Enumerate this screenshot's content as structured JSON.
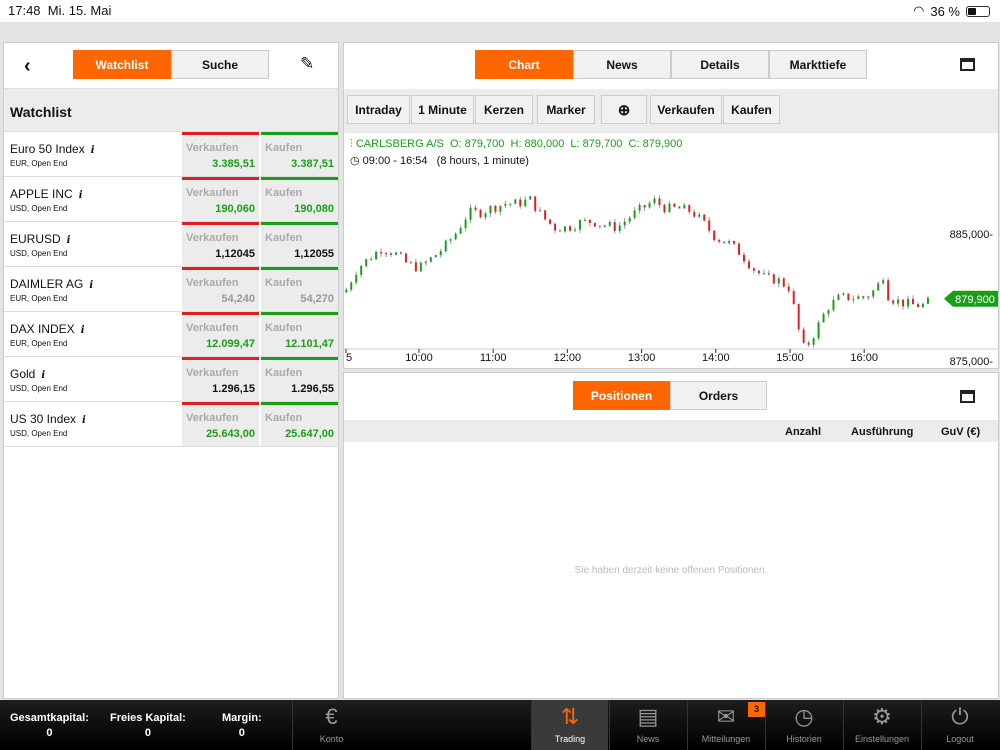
{
  "status": {
    "time": "17:48",
    "date": "Mi. 15. Mai",
    "battery": "36 %",
    "battery_level": 0.36
  },
  "left": {
    "tabs": [
      "Watchlist",
      "Suche"
    ],
    "section_title": "Watchlist",
    "items": [
      {
        "name": "Euro 50 Index",
        "sub": "EUR, Open End",
        "sell": "3.385,51",
        "buy": "3.387,51",
        "color": "green"
      },
      {
        "name": "APPLE INC",
        "sub": "USD, Open End",
        "sell": "190,060",
        "buy": "190,080",
        "color": "green"
      },
      {
        "name": "EURUSD",
        "sub": "USD, Open End",
        "sell": "1,12045",
        "buy": "1,12055",
        "color": "black"
      },
      {
        "name": "DAIMLER AG",
        "sub": "EUR, Open End",
        "sell": "54,240",
        "buy": "54,270",
        "color": "grey"
      },
      {
        "name": "DAX INDEX",
        "sub": "EUR, Open End",
        "sell": "12.099,47",
        "buy": "12.101,47",
        "color": "green"
      },
      {
        "name": "Gold",
        "sub": "USD, Open End",
        "sell": "1.296,15",
        "buy": "1.296,55",
        "color": "black"
      },
      {
        "name": "US 30 Index",
        "sub": "USD, Open End",
        "sell": "25.643,00",
        "buy": "25.647,00",
        "color": "green"
      }
    ],
    "sell_label": "Verkaufen",
    "buy_label": "Kaufen",
    "info": "i"
  },
  "chart_panel": {
    "tabs": [
      "Chart",
      "News",
      "Details",
      "Markttiefe"
    ],
    "toolbar": [
      "Intraday",
      "1 Minute",
      "Kerzen",
      "Marker",
      "Verkaufen",
      "Kaufen"
    ],
    "ohlc": "CARLSBERG A/S  O: 879,700  H: 880,000  L: 879,700  C: 879,900",
    "range": "09:00 - 16:54   (8 hours, 1 minute)"
  },
  "chart_data": {
    "type": "candlestick",
    "symbol": "CARLSBERG A/S",
    "ylim": [
      872.5,
      889
    ],
    "yticks": [
      {
        "v": 885,
        "label": "885,000"
      },
      {
        "v": 875,
        "label": "875,000"
      }
    ],
    "xticks": [
      {
        "h": 9,
        "label": "5"
      },
      {
        "h": 10,
        "label": "10:00"
      },
      {
        "h": 11,
        "label": "11:00"
      },
      {
        "h": 12,
        "label": "12:00"
      },
      {
        "h": 13,
        "label": "13:00"
      },
      {
        "h": 14,
        "label": "14:00"
      },
      {
        "h": 15,
        "label": "15:00"
      },
      {
        "h": 16,
        "label": "16:00"
      }
    ],
    "last": {
      "v": 879.9,
      "label": "879,900"
    },
    "series": [
      [
        9.0,
        880.4
      ],
      [
        9.17,
        882.3
      ],
      [
        9.33,
        883.1
      ],
      [
        9.5,
        883.9
      ],
      [
        9.67,
        883.5
      ],
      [
        9.83,
        882.7
      ],
      [
        10.0,
        882.3
      ],
      [
        10.17,
        883.1
      ],
      [
        10.33,
        883.9
      ],
      [
        10.5,
        885.1
      ],
      [
        10.67,
        886.7
      ],
      [
        10.83,
        886.7
      ],
      [
        11.0,
        887.1
      ],
      [
        11.17,
        887.4
      ],
      [
        11.33,
        887.4
      ],
      [
        11.5,
        887.7
      ],
      [
        11.67,
        886.3
      ],
      [
        11.83,
        885.5
      ],
      [
        12.0,
        885.5
      ],
      [
        12.17,
        885.9
      ],
      [
        12.33,
        886.0
      ],
      [
        12.5,
        885.7
      ],
      [
        12.67,
        885.5
      ],
      [
        12.83,
        886.3
      ],
      [
        13.0,
        887.0
      ],
      [
        13.17,
        887.6
      ],
      [
        13.33,
        887.0
      ],
      [
        13.5,
        887.0
      ],
      [
        13.67,
        886.8
      ],
      [
        13.83,
        885.9
      ],
      [
        14.0,
        884.7
      ],
      [
        14.17,
        884.3
      ],
      [
        14.33,
        883.5
      ],
      [
        14.5,
        882.3
      ],
      [
        14.67,
        881.5
      ],
      [
        14.83,
        881.4
      ],
      [
        15.0,
        880.7
      ],
      [
        15.08,
        878.4
      ],
      [
        15.17,
        876.0
      ],
      [
        15.25,
        876.4
      ],
      [
        15.33,
        877.2
      ],
      [
        15.5,
        879.2
      ],
      [
        15.67,
        880.0
      ],
      [
        15.83,
        880.0
      ],
      [
        16.0,
        880.0
      ],
      [
        16.17,
        880.7
      ],
      [
        16.25,
        881.9
      ],
      [
        16.33,
        880.0
      ],
      [
        16.5,
        879.6
      ],
      [
        16.67,
        879.4
      ],
      [
        16.83,
        879.4
      ],
      [
        16.9,
        879.9
      ]
    ]
  },
  "positions": {
    "tabs": [
      "Positionen",
      "Orders"
    ],
    "columns": [
      "Anzahl",
      "Ausführung",
      "GuV (€)"
    ],
    "empty": "Sie haben derzeit keine offenen Positionen."
  },
  "bottom": {
    "stats": [
      {
        "label": "Gesamtkapital:",
        "value": "0"
      },
      {
        "label": "Freies Kapital:",
        "value": "0"
      },
      {
        "label": "Margin:",
        "value": "0"
      }
    ],
    "tabs": [
      {
        "label": "Konto",
        "icon": "€"
      },
      {
        "label": "Trading",
        "icon": "⇅"
      },
      {
        "label": "News",
        "icon": "▤"
      },
      {
        "label": "Mitteilungen",
        "icon": "✉",
        "badge": "3"
      },
      {
        "label": "Historien",
        "icon": "◷"
      },
      {
        "label": "Einstellungen",
        "icon": "⚙"
      },
      {
        "label": "Logout",
        "icon": "⏻"
      }
    ]
  },
  "colors": {
    "accent": "#ff6600",
    "up": "#1a9e1a",
    "down": "#e02020"
  }
}
